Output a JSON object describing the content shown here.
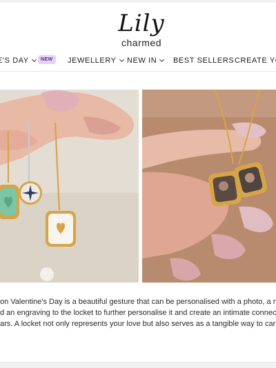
{
  "brand": {
    "logo_script": "Lily",
    "logo_sub": "charmed"
  },
  "nav": {
    "items": [
      {
        "label": "E'S DAY",
        "has_chevron": true
      },
      {
        "label": "JEWELLERY",
        "has_chevron": true
      },
      {
        "label": "NEW IN",
        "has_chevron": true
      },
      {
        "label": "BEST SELLERS",
        "has_chevron": false
      },
      {
        "label": "CREATE YOU",
        "has_chevron": false
      }
    ],
    "badge": "NEW"
  },
  "images": [
    {
      "alt": "Hand holding gold and silver charm necklaces"
    },
    {
      "alt": "Hand holding an open gold locket with photos"
    }
  ],
  "article": {
    "lines": [
      "on Valentine's Day is a beautiful gesture that can be personalised with a photo, a note",
      "d an engraving to the locket to further personalise it and create an intimate connection",
      "ars. A locket not only represents your love but also serves as a tangible way to carry yo"
    ]
  },
  "colors": {
    "accent_badge_bg": "#e4d4f4",
    "accent_badge_text": "#5a2a86",
    "gold": "#d6a548"
  }
}
